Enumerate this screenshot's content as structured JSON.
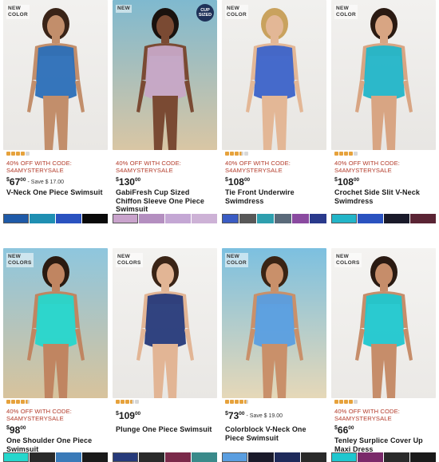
{
  "products": [
    {
      "badge": "NEW\nCOLOR",
      "cup_badge": "",
      "rating": 4,
      "promo": "40% OFF WITH CODE:\nS4AMYSTERYSALE",
      "price_whole": "67",
      "price_cents": "00",
      "save": "- Save $ 17.00",
      "title": "V-Neck One Piece Swimsuit",
      "bg": [
        "#f2f1ef",
        "#e9e7e4"
      ],
      "garment": "#2b6fb8",
      "skin": "#c28e6b",
      "hair": "#3a2418",
      "swatches": [
        "#1e5aa8",
        "#1f8fb2",
        "#2a52c0",
        "#0a0a0a"
      ]
    },
    {
      "badge": "NEW",
      "cup_badge": "CUP\nSIZED",
      "rating": 0,
      "promo": "40% OFF WITH CODE:\nS4AMYSTERYSALE",
      "price_whole": "130",
      "price_cents": "00",
      "save": "",
      "title": "GabiFresh Cup Sized Chiffon Sleeve One Piece Swimsuit",
      "bg": [
        "#7fb9cf",
        "#d9c6a4"
      ],
      "garment": "#c7a6c6",
      "skin": "#7a4a33",
      "hair": "#1a120e",
      "swatches": [
        "#c9a3cc",
        "#b48fc0",
        "#c4a7d4",
        "#cdb2d6"
      ]
    },
    {
      "badge": "NEW\nCOLOR",
      "cup_badge": "",
      "rating": 3.5,
      "promo": "40% OFF WITH CODE:\nS4AMYSTERYSALE",
      "price_whole": "108",
      "price_cents": "00",
      "save": "",
      "title": "Tie Front Underwire Swimdress",
      "bg": [
        "#f1f0ee",
        "#e8e6e2"
      ],
      "garment": "#3c63c9",
      "skin": "#e3b796",
      "hair": "#c9a25e",
      "swatches": [
        "#3a5cc4",
        "#585858",
        "#2e9fae",
        "#5a6a7a",
        "#8a4aa0",
        "#2a3a8c"
      ]
    },
    {
      "badge": "NEW\nCOLOR",
      "cup_badge": "",
      "rating": 4,
      "promo": "40% OFF WITH CODE:\nS4AMYSTERYSALE",
      "price_whole": "108",
      "price_cents": "00",
      "save": "",
      "title": "Crochet Side Slit V-Neck Swimdress",
      "bg": [
        "#f2f1ef",
        "#e8e6e3"
      ],
      "garment": "#22b5c8",
      "skin": "#d8a583",
      "hair": "#2a1a12",
      "swatches": [
        "#22b5c8",
        "#2a52c0",
        "#1a1a2a",
        "#5a2434"
      ]
    },
    {
      "badge": "NEW\nCOLORS",
      "cup_badge": "",
      "rating": 4.5,
      "promo": "40% OFF WITH CODE:\nS4AMYSTERYSALE",
      "price_whole": "98",
      "price_cents": "00",
      "save": "",
      "title": "One Shoulder One Piece Swimsuit",
      "bg": [
        "#8ec6de",
        "#d8c39c"
      ],
      "garment": "#26d7cc",
      "skin": "#c08561",
      "hair": "#2a1a10",
      "swatches": [
        "#26d7cc",
        "#2a2a2a",
        "#3a7ab8",
        "#1a1a1a"
      ]
    },
    {
      "badge": "NEW\nCOLORS",
      "cup_badge": "",
      "rating": 3.5,
      "promo": "",
      "price_whole": "109",
      "price_cents": "00",
      "save": "",
      "title": "Plunge One Piece Swimsuit",
      "bg": [
        "#f3f2f0",
        "#e9e7e4"
      ],
      "garment": "#263a7a",
      "skin": "#e2b595",
      "hair": "#3a2416",
      "swatches": [
        "#263a7a",
        "#2a2a2a",
        "#7a2a4a",
        "#3a8a8a"
      ]
    },
    {
      "badge": "NEW\nCOLOR",
      "cup_badge": "",
      "rating": 4.5,
      "promo": "",
      "price_whole": "73",
      "price_cents": "00",
      "save": "- Save $ 19.00",
      "title": "Colorblock V-Neck One Piece Swimsuit",
      "bg": [
        "#7cc0e0",
        "#e6d8b8"
      ],
      "garment": "#5a9ee0",
      "skin": "#c9906a",
      "hair": "#3a2414",
      "swatches": [
        "#5a9ee0",
        "#1a1a2a",
        "#1e2a5a",
        "#2a2a2a"
      ]
    },
    {
      "badge": "NEW\nCOLORS",
      "cup_badge": "",
      "rating": 4,
      "promo": "40% OFF WITH CODE:\nS4AMYSTERYSALE",
      "price_whole": "66",
      "price_cents": "00",
      "save": "",
      "title": "Tenley Surplice Cover Up Maxi Dress",
      "bg": [
        "#f4f3f1",
        "#ebe9e6"
      ],
      "garment": "#1fc7cf",
      "skin": "#c68d6a",
      "hair": "#2a1a12",
      "swatches": [
        "#1fc7cf",
        "#7a2a6a",
        "#2a2a2a",
        "#1a1a1a"
      ]
    }
  ],
  "colors": {
    "star_on": "#e6a23c",
    "star_off": "#d8d8d8",
    "promo": "#b33b2a"
  }
}
